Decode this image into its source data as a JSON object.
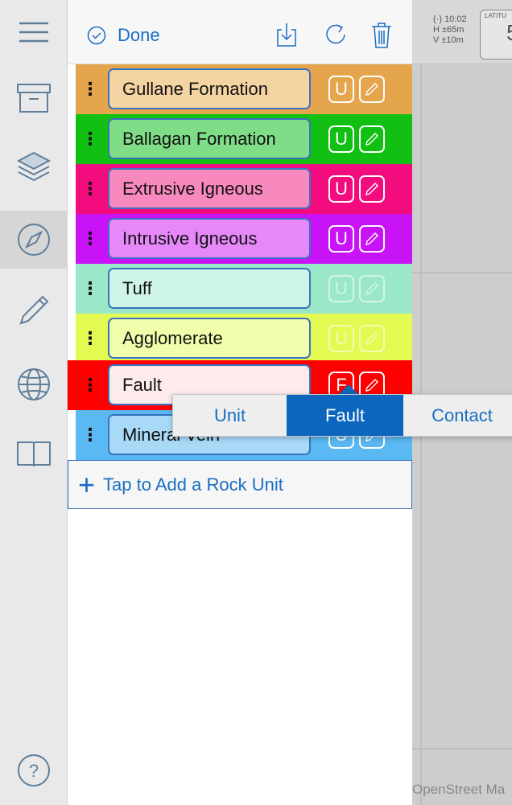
{
  "sidebar": {
    "items": [
      {
        "icon": "menu-icon"
      },
      {
        "icon": "archive-box-icon"
      },
      {
        "icon": "layers-icon"
      },
      {
        "icon": "compass-icon",
        "active": true
      },
      {
        "icon": "pencil-icon"
      },
      {
        "icon": "globe-icon"
      },
      {
        "icon": "book-icon"
      },
      {
        "icon": "help-icon",
        "label": "?"
      }
    ]
  },
  "toolbar": {
    "done_label": "Done",
    "icons": [
      "download-icon",
      "refresh-icon",
      "trash-icon"
    ]
  },
  "rock_units": [
    {
      "name": "Gullane Formation",
      "tag": "U",
      "row_color": "#E5A54D",
      "field_color": "#F4D4A2"
    },
    {
      "name": "Ballagan Formation",
      "tag": "U",
      "row_color": "#11C013",
      "field_color": "#7EDD86"
    },
    {
      "name": "Extrusive Igneous",
      "tag": "U",
      "row_color": "#F20C7D",
      "field_color": "#F889BE"
    },
    {
      "name": "Intrusive Igneous",
      "tag": "U",
      "row_color": "#C713F5",
      "field_color": "#E687FA"
    },
    {
      "name": "Tuff",
      "tag": "U",
      "row_color": "#9BE8C9",
      "field_color": "#CFF5E6"
    },
    {
      "name": "Agglomerate",
      "tag": "U",
      "row_color": "#E3FA53",
      "field_color": "#F1FDAA"
    },
    {
      "name": "Fault",
      "tag": "F",
      "row_color": "#FE0000",
      "field_color": "#FDEAEA"
    },
    {
      "name": "Mineral Vein",
      "tag": "U",
      "row_color": "#5AB8F2",
      "field_color": "#A8DAF8"
    }
  ],
  "add_button": {
    "label": "Tap to Add a Rock Unit",
    "icon": "plus-icon"
  },
  "type_menu": {
    "options": [
      "Unit",
      "Fault",
      "Contact"
    ],
    "selected": "Fault"
  },
  "map": {
    "gps": {
      "time": "10:02",
      "horizontal": "H ±65m",
      "vertical": "V ±10m"
    },
    "latitude_label": "LATITU",
    "latitude_value": "5",
    "attribution": "OpenStreet Ma"
  },
  "colors": {
    "accent": "#1A6EC2",
    "selected_segment": "#0C66BD",
    "sidebar_bg": "#E9E9E9"
  }
}
